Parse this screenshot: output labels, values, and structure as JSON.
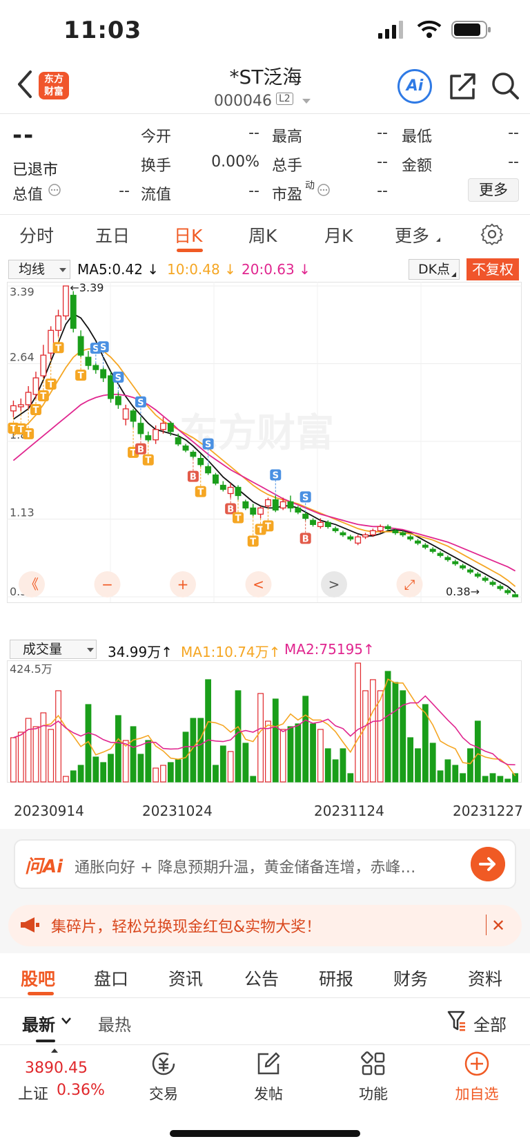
{
  "status_bar": {
    "time": "11:03"
  },
  "header": {
    "logo_text": "东方财富",
    "stock_name": "*ST泛海",
    "stock_code": "000046",
    "level_badge": "L2",
    "ai_label": "Ai"
  },
  "quote": {
    "price": "--",
    "status": "已退市",
    "fields": [
      {
        "label": "今开",
        "value": "--"
      },
      {
        "label": "最高",
        "value": "--"
      },
      {
        "label": "最低",
        "value": "--"
      },
      {
        "label": "换手",
        "value": "0.00%"
      },
      {
        "label": "总手",
        "value": "--"
      },
      {
        "label": "金额",
        "value": "--"
      },
      {
        "label": "总值",
        "value": "--"
      },
      {
        "label": "流值",
        "value": "--"
      },
      {
        "label": "市盈",
        "value": "--",
        "superscript": "动"
      }
    ],
    "more_label": "更多"
  },
  "chart_tabs": {
    "items": [
      "分时",
      "五日",
      "日K",
      "周K",
      "月K",
      "更多"
    ],
    "active": "日K"
  },
  "ma_bar": {
    "select_label": "均线",
    "ma5": "MA5:0.42",
    "ma10": "10:0.48",
    "ma20": "20:0.63",
    "dk_label": "DK点",
    "adjust_label": "不复权",
    "colors": {
      "ma5": "#111111",
      "ma10": "#f5a623",
      "ma20": "#e0268f",
      "up": "#e0272b",
      "down": "#1a9e1a"
    }
  },
  "kline_controls": [
    "《",
    "−",
    "+",
    "<",
    ">",
    "⤢"
  ],
  "volume_bar": {
    "select_label": "成交量",
    "vol": "34.99万",
    "ma1": "MA1:10.74万",
    "ma2": "MA2:75195"
  },
  "chart_data": [
    {
      "type": "candlestick",
      "y_labels": [
        "3.39",
        "2.64",
        "1.89",
        "1.13",
        "0.38"
      ],
      "ylim": [
        0.38,
        3.39
      ],
      "high_annotation": "3.39",
      "low_annotation": "0.38",
      "watermark": "东方财富",
      "candles": [
        [
          2.18,
          2.23,
          2.12,
          2.28
        ],
        [
          2.22,
          2.24,
          2.18,
          2.3
        ],
        [
          2.24,
          2.36,
          2.2,
          2.42
        ],
        [
          2.34,
          2.5,
          2.3,
          2.56
        ],
        [
          2.52,
          2.72,
          2.5,
          2.82
        ],
        [
          2.74,
          2.96,
          2.68,
          3.0
        ],
        [
          2.96,
          3.1,
          2.9,
          3.16
        ],
        [
          3.1,
          3.39,
          3.06,
          3.39
        ],
        [
          3.3,
          2.98,
          2.94,
          3.34
        ],
        [
          2.9,
          2.72,
          2.7,
          2.96
        ],
        [
          2.7,
          2.62,
          2.58,
          2.76
        ],
        [
          2.62,
          2.58,
          2.54,
          2.64
        ],
        [
          2.58,
          2.5,
          2.46,
          2.6
        ],
        [
          2.52,
          2.3,
          2.26,
          2.56
        ],
        [
          2.32,
          2.24,
          2.2,
          2.36
        ],
        [
          2.1,
          2.2,
          2.04,
          2.24
        ],
        [
          2.18,
          2.08,
          2.02,
          2.2
        ],
        [
          2.06,
          1.96,
          1.92,
          2.12
        ],
        [
          1.94,
          1.9,
          1.88,
          1.98
        ],
        [
          1.9,
          2.0,
          1.86,
          2.04
        ],
        [
          2.0,
          2.06,
          1.96,
          2.12
        ],
        [
          2.06,
          1.98,
          1.94,
          2.08
        ],
        [
          1.92,
          1.86,
          1.84,
          1.96
        ],
        [
          1.84,
          1.8,
          1.78,
          1.86
        ],
        [
          1.78,
          1.74,
          1.72,
          1.8
        ],
        [
          1.72,
          1.66,
          1.64,
          1.76
        ],
        [
          1.64,
          1.58,
          1.56,
          1.66
        ],
        [
          1.56,
          1.48,
          1.46,
          1.58
        ],
        [
          1.46,
          1.42,
          1.4,
          1.5
        ],
        [
          1.38,
          1.44,
          1.34,
          1.48
        ],
        [
          1.44,
          1.36,
          1.32,
          1.46
        ],
        [
          1.3,
          1.24,
          1.22,
          1.32
        ],
        [
          1.24,
          1.18,
          1.16,
          1.28
        ],
        [
          1.18,
          1.24,
          1.14,
          1.26
        ],
        [
          1.26,
          1.32,
          1.24,
          1.34
        ],
        [
          1.32,
          1.22,
          1.2,
          1.36
        ],
        [
          1.24,
          1.3,
          1.22,
          1.34
        ],
        [
          1.3,
          1.24,
          1.2,
          1.36
        ],
        [
          1.24,
          1.2,
          1.18,
          1.26
        ],
        [
          1.18,
          1.14,
          1.12,
          1.2
        ],
        [
          1.12,
          1.08,
          1.06,
          1.14
        ],
        [
          1.06,
          1.1,
          1.04,
          1.14
        ],
        [
          1.1,
          1.06,
          1.04,
          1.12
        ],
        [
          1.04,
          1.02,
          1.0,
          1.06
        ],
        [
          1.0,
          0.98,
          0.96,
          1.02
        ],
        [
          0.96,
          0.94,
          0.92,
          0.98
        ],
        [
          0.9,
          0.96,
          0.88,
          0.98
        ],
        [
          0.96,
          0.98,
          0.94,
          1.0
        ],
        [
          0.98,
          1.02,
          0.96,
          1.04
        ],
        [
          1.02,
          1.06,
          1.0,
          1.08
        ],
        [
          1.06,
          1.04,
          1.02,
          1.08
        ],
        [
          1.02,
          1.0,
          0.98,
          1.04
        ],
        [
          1.0,
          0.98,
          0.96,
          1.02
        ],
        [
          0.96,
          0.94,
          0.92,
          0.98
        ],
        [
          0.92,
          0.9,
          0.88,
          0.94
        ],
        [
          0.88,
          0.86,
          0.84,
          0.9
        ],
        [
          0.84,
          0.82,
          0.8,
          0.86
        ],
        [
          0.8,
          0.78,
          0.76,
          0.82
        ],
        [
          0.76,
          0.74,
          0.72,
          0.78
        ],
        [
          0.72,
          0.7,
          0.68,
          0.74
        ],
        [
          0.68,
          0.66,
          0.64,
          0.7
        ],
        [
          0.64,
          0.62,
          0.6,
          0.66
        ],
        [
          0.6,
          0.58,
          0.56,
          0.62
        ],
        [
          0.56,
          0.54,
          0.52,
          0.58
        ],
        [
          0.52,
          0.5,
          0.48,
          0.54
        ],
        [
          0.48,
          0.46,
          0.44,
          0.5
        ],
        [
          0.44,
          0.42,
          0.4,
          0.46
        ],
        [
          0.4,
          0.38,
          0.38,
          0.42
        ]
      ],
      "series": [
        {
          "name": "MA5",
          "values": [
            2.1,
            2.15,
            2.2,
            2.32,
            2.48,
            2.66,
            2.84,
            3.02,
            3.12,
            3.08,
            2.98,
            2.86,
            2.7,
            2.56,
            2.44,
            2.32,
            2.22,
            2.14,
            2.06,
            2.0,
            1.98,
            1.96,
            1.94,
            1.9,
            1.84,
            1.77,
            1.7,
            1.62,
            1.54,
            1.48,
            1.42,
            1.36,
            1.3,
            1.26,
            1.24,
            1.24,
            1.26,
            1.26,
            1.24,
            1.2,
            1.16,
            1.12,
            1.1,
            1.08,
            1.05,
            1.02,
            0.99,
            0.97,
            0.97,
            0.99,
            1.02,
            1.03,
            1.02,
            1.0,
            0.96,
            0.92,
            0.88,
            0.84,
            0.8,
            0.76,
            0.72,
            0.68,
            0.64,
            0.6,
            0.56,
            0.52,
            0.48,
            0.42
          ]
        },
        {
          "name": "MA10",
          "values": [
            1.94,
            2.0,
            2.06,
            2.14,
            2.24,
            2.36,
            2.48,
            2.6,
            2.7,
            2.76,
            2.78,
            2.78,
            2.76,
            2.7,
            2.62,
            2.52,
            2.42,
            2.32,
            2.22,
            2.14,
            2.08,
            2.04,
            2.0,
            1.96,
            1.92,
            1.87,
            1.82,
            1.76,
            1.7,
            1.64,
            1.58,
            1.52,
            1.46,
            1.41,
            1.37,
            1.34,
            1.32,
            1.3,
            1.28,
            1.25,
            1.22,
            1.19,
            1.16,
            1.13,
            1.1,
            1.07,
            1.04,
            1.02,
            1.01,
            1.01,
            1.01,
            1.01,
            1.0,
            0.99,
            0.97,
            0.95,
            0.93,
            0.9,
            0.87,
            0.83,
            0.79,
            0.75,
            0.71,
            0.67,
            0.63,
            0.59,
            0.54,
            0.48
          ]
        },
        {
          "name": "MA20",
          "values": [
            1.7,
            1.76,
            1.82,
            1.88,
            1.94,
            2.0,
            2.06,
            2.12,
            2.18,
            2.24,
            2.28,
            2.31,
            2.33,
            2.34,
            2.34,
            2.33,
            2.31,
            2.28,
            2.24,
            2.19,
            2.13,
            2.07,
            2.0,
            1.94,
            1.88,
            1.82,
            1.76,
            1.71,
            1.66,
            1.61,
            1.57,
            1.53,
            1.49,
            1.45,
            1.41,
            1.37,
            1.33,
            1.3,
            1.27,
            1.24,
            1.21,
            1.18,
            1.16,
            1.14,
            1.12,
            1.1,
            1.08,
            1.07,
            1.06,
            1.06,
            1.05,
            1.04,
            1.03,
            1.01,
            0.99,
            0.97,
            0.95,
            0.93,
            0.91,
            0.88,
            0.85,
            0.82,
            0.79,
            0.76,
            0.73,
            0.7,
            0.67,
            0.63
          ]
        }
      ],
      "markers": [
        {
          "label": "T",
          "index": 0
        },
        {
          "label": "T",
          "index": 1
        },
        {
          "label": "T",
          "index": 2
        },
        {
          "label": "T",
          "index": 3
        },
        {
          "label": "T",
          "index": 4
        },
        {
          "label": "T",
          "index": 5
        },
        {
          "label": "T",
          "index": 6
        },
        {
          "label": "T",
          "index": 9
        },
        {
          "label": "S",
          "index": 11
        },
        {
          "label": "S",
          "index": 12
        },
        {
          "label": "S",
          "index": 14
        },
        {
          "label": "T",
          "index": 16
        },
        {
          "label": "B",
          "index": 17
        },
        {
          "label": "T",
          "index": 18
        },
        {
          "label": "S",
          "index": 17
        },
        {
          "label": "S",
          "index": 26
        },
        {
          "label": "B",
          "index": 24
        },
        {
          "label": "T",
          "index": 25
        },
        {
          "label": "B",
          "index": 29
        },
        {
          "label": "T",
          "index": 30
        },
        {
          "label": "T",
          "index": 32
        },
        {
          "label": "T",
          "index": 33
        },
        {
          "label": "T",
          "index": 34
        },
        {
          "label": "S",
          "index": 35
        },
        {
          "label": "S",
          "index": 39
        },
        {
          "label": "B",
          "index": 39
        }
      ]
    },
    {
      "type": "bar",
      "y_labels": [
        "424.5万"
      ],
      "x_labels": [
        "20230914",
        "20231024",
        "20231124",
        "20231227"
      ],
      "values": [
        160,
        180,
        230,
        200,
        250,
        190,
        330,
        20,
        40,
        60,
        280,
        90,
        70,
        100,
        240,
        150,
        200,
        100,
        150,
        50,
        60,
        70,
        80,
        180,
        230,
        230,
        370,
        60,
        130,
        110,
        330,
        140,
        20,
        320,
        220,
        300,
        190,
        200,
        210,
        310,
        210,
        190,
        120,
        80,
        120,
        30,
        430,
        330,
        370,
        330,
        400,
        360,
        330,
        160,
        120,
        280,
        140,
        40,
        80,
        60,
        30,
        120,
        220,
        20,
        30,
        20,
        10,
        30
      ]
    }
  ],
  "ai_bar": {
    "logo": "问Ai",
    "prompt": "通胀向好 + 降息预期升温，黄金储备连增，赤峰…"
  },
  "promo": {
    "text": "集碎片，轻松兑换现金红包&实物大奖！",
    "close": "✕"
  },
  "content_tabs": {
    "items": [
      "股吧",
      "盘口",
      "资讯",
      "公告",
      "研报",
      "财务",
      "资料"
    ],
    "active": "股吧"
  },
  "sort": {
    "newest": "最新",
    "hot": "最热",
    "filter": "全部"
  },
  "bottom_nav": {
    "index_value": "3890.45",
    "index_name": "上证",
    "index_change": "0.36%",
    "items": [
      {
        "label": "交易",
        "icon": "trade-icon"
      },
      {
        "label": "发帖",
        "icon": "post-icon"
      },
      {
        "label": "功能",
        "icon": "apps-icon"
      },
      {
        "label": "加自选",
        "icon": "add-watchlist-icon"
      }
    ]
  }
}
